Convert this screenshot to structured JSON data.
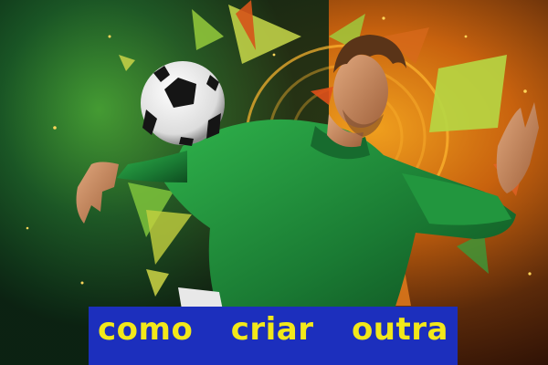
{
  "caption": {
    "words": [
      "como",
      "criar",
      "outra"
    ]
  },
  "colors": {
    "banner": "#1c2fbd",
    "caption_text": "#f2e81a",
    "shirt": "#1f8a3a",
    "background_left": "#0d3b22",
    "background_right": "#e0500f"
  }
}
